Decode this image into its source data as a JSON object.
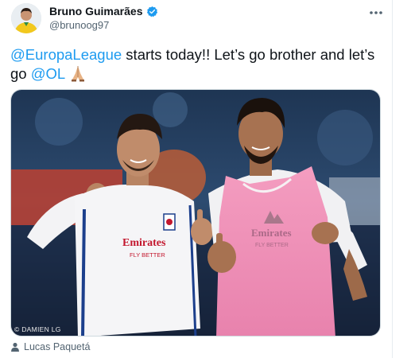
{
  "tweet": {
    "author_name": "Bruno Guimarães",
    "author_handle": "@brunoog97",
    "text_mention_1": "@EuropaLeague",
    "text_part_1": " starts today!! Let’s go brother and let’s go ",
    "text_mention_2": "@OL",
    "emoji": "folded-hands",
    "photo_credit": "© DAMIEN LG",
    "tagged_user": "Lucas Paquetá",
    "jersey_left_sponsor": "Emirates",
    "jersey_left_sponsor_sub": "FLY BETTER",
    "jersey_right_sponsor": "Emirates",
    "jersey_right_sponsor_sub": "FLY BETTER"
  },
  "colors": {
    "link": "#1d9bf0",
    "verified": "#1d9bf0",
    "bib_pink": "#ee8fb6",
    "text_primary": "#0f1419",
    "text_secondary": "#536471"
  },
  "icons": {
    "more": "more-dots-icon",
    "verified": "verified-badge-icon",
    "tag": "person-icon"
  }
}
